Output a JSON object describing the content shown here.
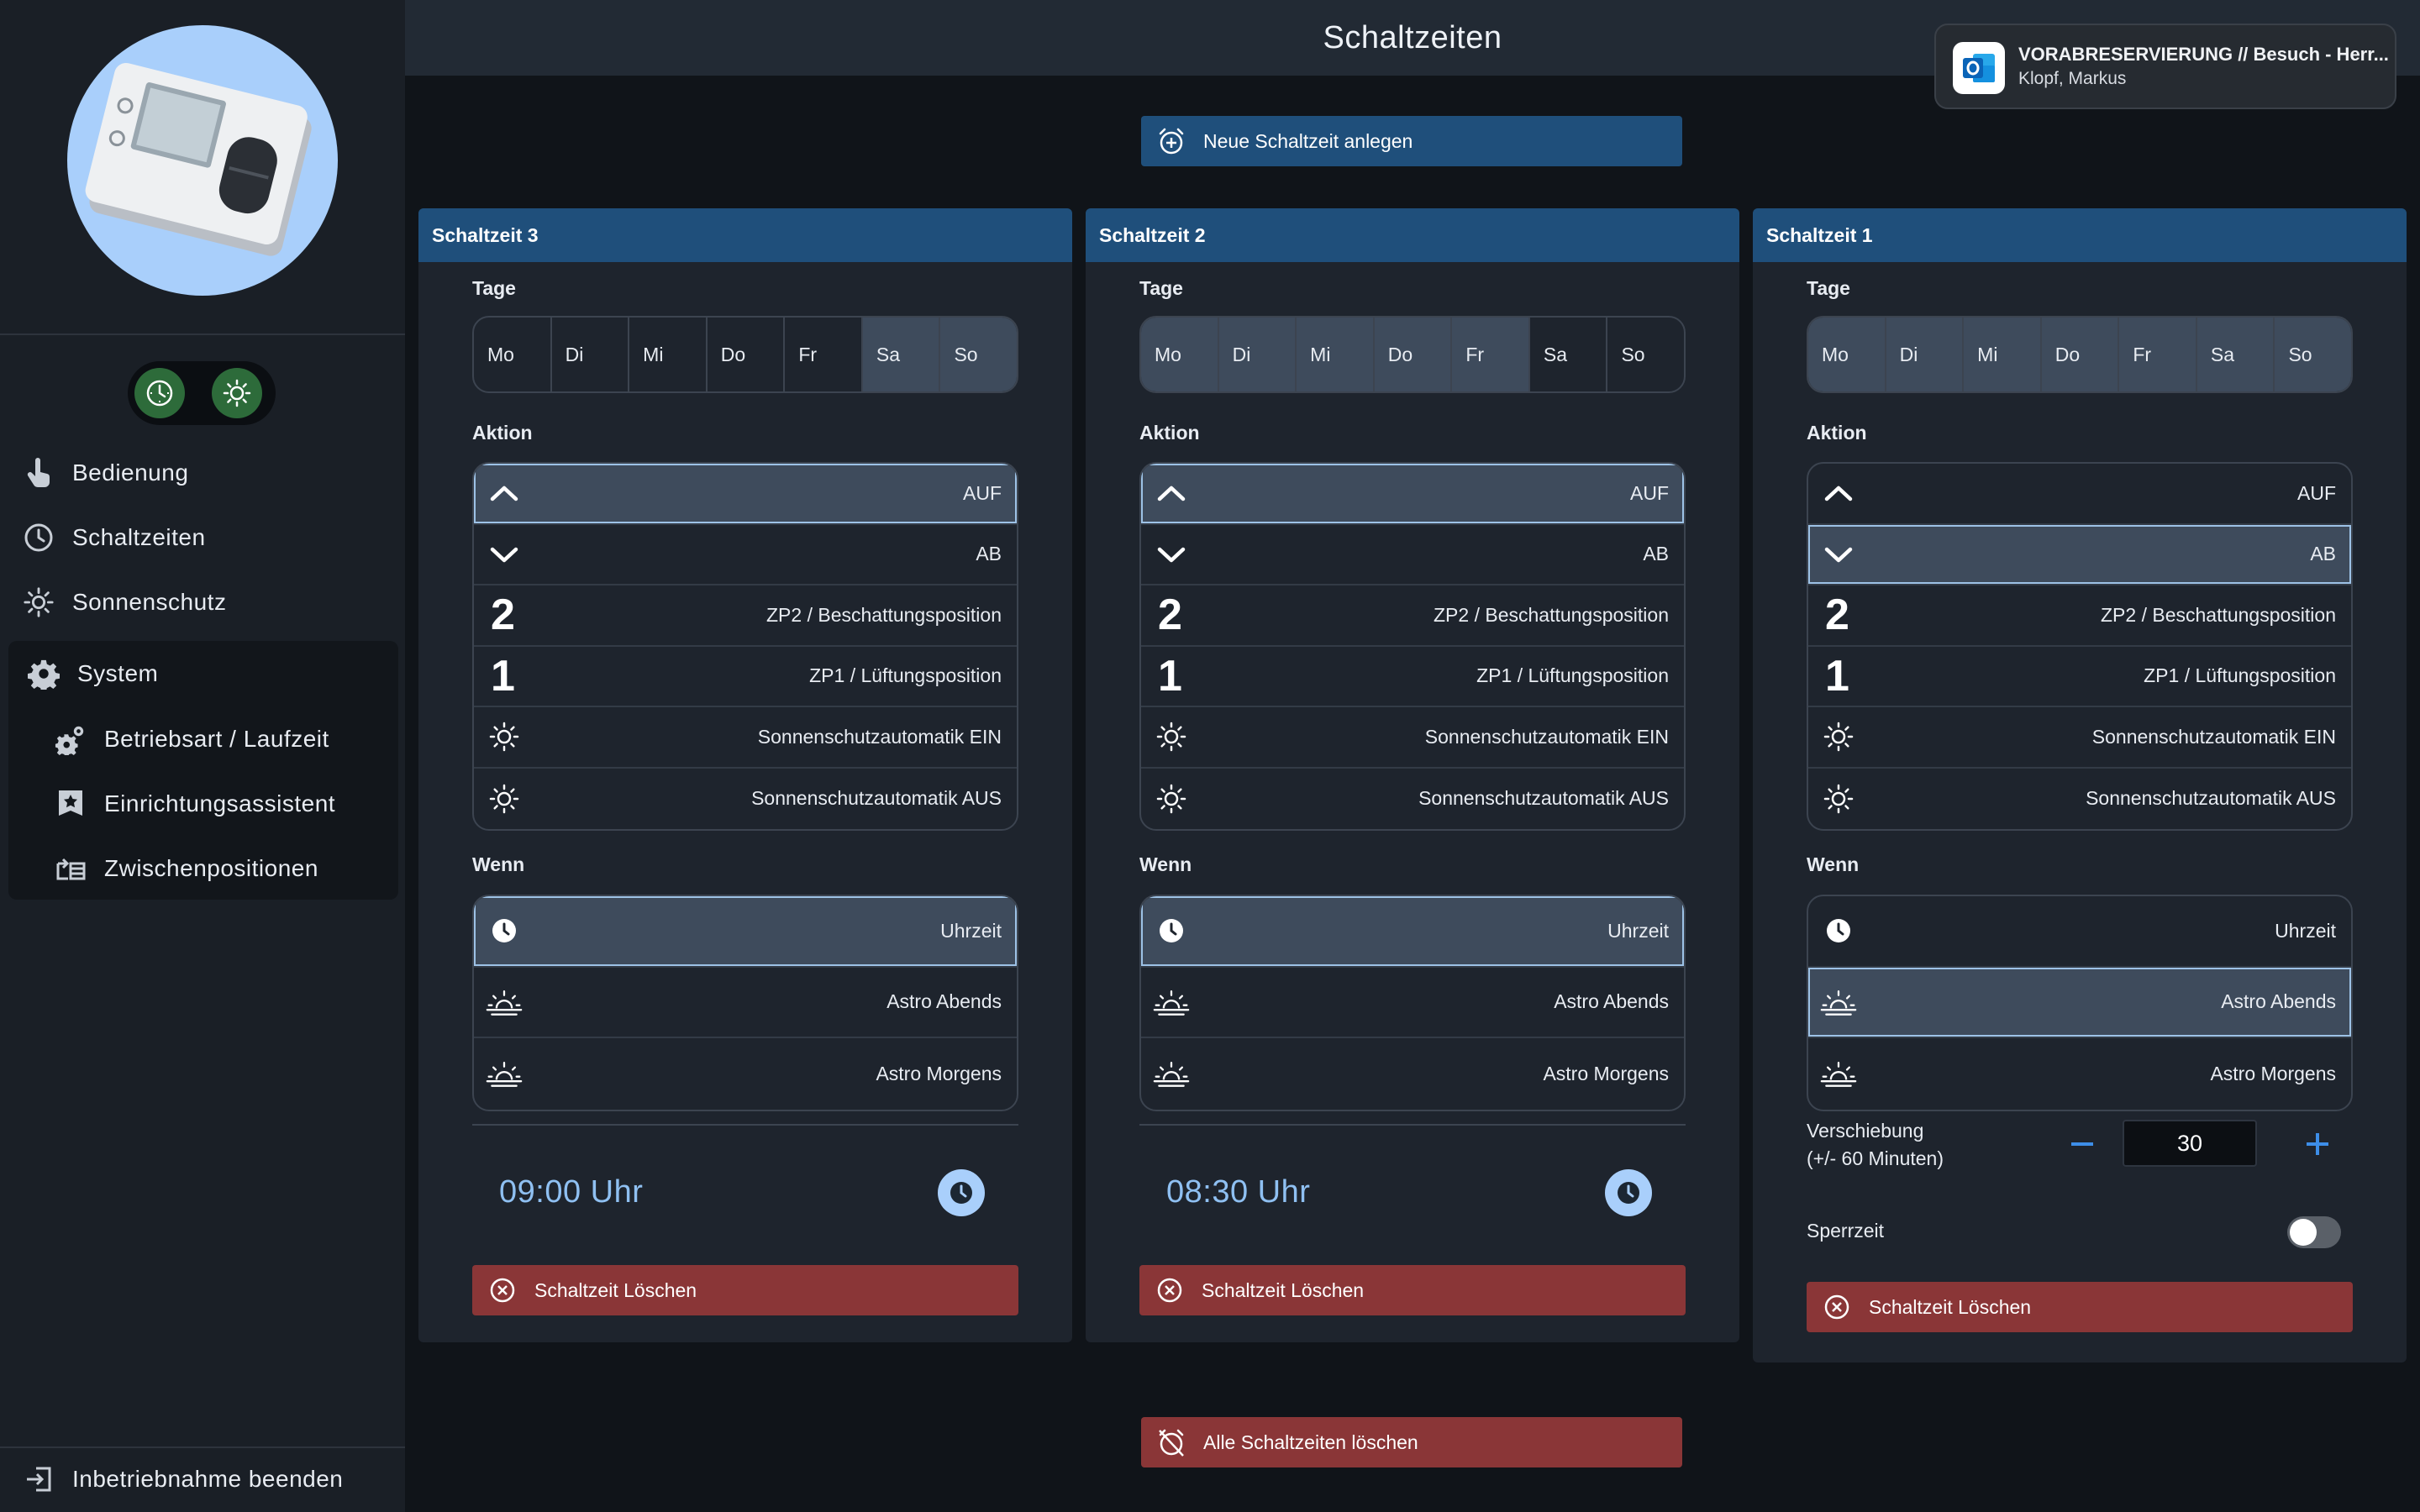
{
  "header": {
    "title": "Schaltzeiten"
  },
  "notification": {
    "app_icon": "outlook-icon",
    "title": "VORABRESERVIERUNG // Besuch - Herr...",
    "sender": "Klopf, Markus"
  },
  "sidebar": {
    "mode_icons": [
      "clock-icon",
      "sun-icon"
    ],
    "items": [
      {
        "label": "Bedienung",
        "icon": "touch-icon"
      },
      {
        "label": "Schaltzeiten",
        "icon": "clock-icon"
      },
      {
        "label": "Sonnenschutz",
        "icon": "sun-icon"
      }
    ],
    "system": {
      "label": "System",
      "icon": "gear-icon",
      "children": [
        {
          "label": "Betriebsart / Laufzeit",
          "icon": "gears-icon"
        },
        {
          "label": "Einrichtungsassistent",
          "icon": "wizard-icon"
        },
        {
          "label": "Zwischenpositionen",
          "icon": "positions-icon"
        }
      ]
    },
    "footer": {
      "label": "Inbetriebnahme beenden",
      "icon": "exit-icon"
    }
  },
  "toolbar": {
    "new_label": "Neue Schaltzeit anlegen",
    "delete_all_label": "Alle Schaltzeiten löschen"
  },
  "labels": {
    "days": "Tage",
    "action": "Aktion",
    "when": "Wenn",
    "delete": "Schaltzeit Löschen",
    "shift_line1": "Verschiebung",
    "shift_line2": "(+/- 60 Minuten)",
    "lock": "Sperrzeit"
  },
  "weekdays": [
    "Mo",
    "Di",
    "Mi",
    "Do",
    "Fr",
    "Sa",
    "So"
  ],
  "actions": [
    "AUF",
    "AB",
    "ZP2 / Beschattungsposition",
    "ZP1 / Lüftungsposition",
    "Sonnenschutzautomatik EIN",
    "Sonnenschutzautomatik AUS"
  ],
  "triggers": [
    "Uhrzeit",
    "Astro Abends",
    "Astro Morgens"
  ],
  "cards": [
    {
      "title": "Schaltzeit 3",
      "selected_days": [
        "Sa",
        "So"
      ],
      "selected_action": "AUF",
      "selected_trigger": "Uhrzeit",
      "time": "09:00 Uhr"
    },
    {
      "title": "Schaltzeit 2",
      "selected_days": [
        "Mo",
        "Di",
        "Mi",
        "Do",
        "Fr"
      ],
      "selected_action": "AUF",
      "selected_trigger": "Uhrzeit",
      "time": "08:30 Uhr"
    },
    {
      "title": "Schaltzeit 1",
      "selected_days": [
        "Mo",
        "Di",
        "Mi",
        "Do",
        "Fr",
        "Sa",
        "So"
      ],
      "selected_action": "AB",
      "selected_trigger": "Astro Abends",
      "shift_minutes": "30",
      "lock_enabled": false
    }
  ],
  "colors": {
    "accent_blue": "#1f4f7b",
    "danger_red": "#8a3637",
    "time_text": "#8fc0f2",
    "selected_bg": "#3e4b5c",
    "mode_green": "#2d6b3a"
  }
}
